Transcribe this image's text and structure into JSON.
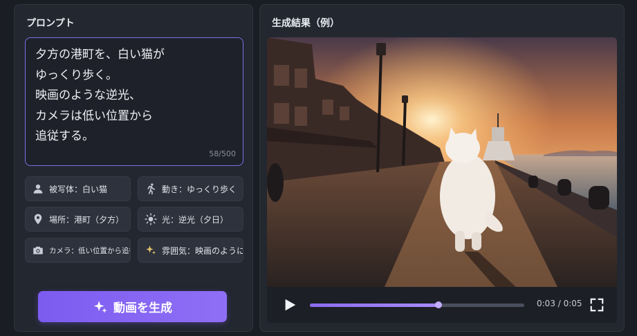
{
  "prompt_panel": {
    "title": "プロンプト",
    "prompt_lines": [
      "夕方の港町を、白い猫が",
      "ゆっくり歩く。",
      "映画のような逆光、",
      "カメラは低い位置から",
      "追従する。"
    ],
    "char_count": "58/500",
    "chips": [
      {
        "icon": "person-icon",
        "label": "被写体：白い猫"
      },
      {
        "icon": "running-person-icon",
        "label": "動き：ゆっくり歩く"
      },
      {
        "icon": "location-pin-icon",
        "label": "場所：港町（夕方）"
      },
      {
        "icon": "sun-icon",
        "label": "光：逆光（夕日）"
      },
      {
        "icon": "camera-icon",
        "label": "カメラ：低い位置から追従"
      },
      {
        "icon": "sparkle-icon",
        "label": "雰囲気：映画のように"
      }
    ],
    "generate_label": "動画を生成"
  },
  "result_panel": {
    "title": "生成結果（例）",
    "time": "0:03 / 0:05",
    "progress": 0.6
  },
  "colors": {
    "accent": "#7c5cf0",
    "panel": "#232730",
    "background": "#1a1d24"
  }
}
